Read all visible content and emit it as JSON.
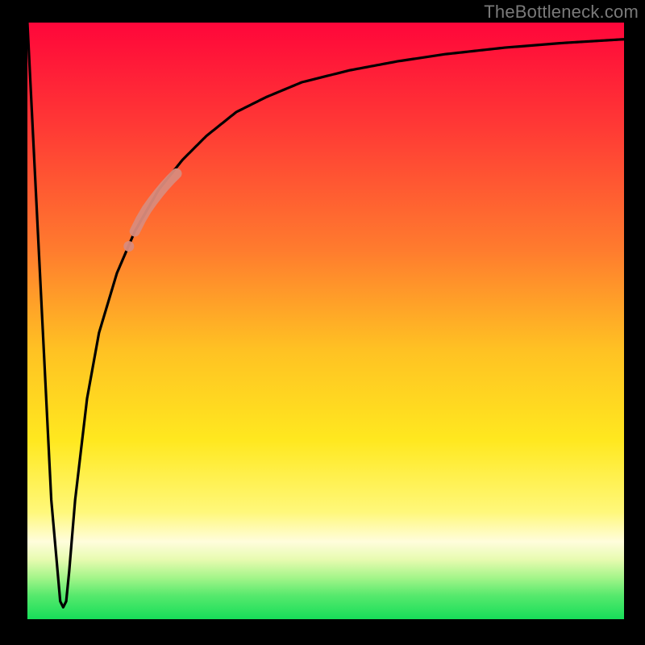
{
  "watermark": "TheBottleneck.com",
  "chart_data": {
    "type": "line",
    "title": "",
    "xlabel": "",
    "ylabel": "",
    "xlim": [
      0,
      100
    ],
    "ylim": [
      0,
      100
    ],
    "grid": false,
    "legend": false,
    "background_gradient": {
      "direction": "vertical",
      "stops": [
        {
          "pos": 0.0,
          "color": "#ff063a"
        },
        {
          "pos": 0.18,
          "color": "#ff3b35"
        },
        {
          "pos": 0.38,
          "color": "#ff7b2e"
        },
        {
          "pos": 0.55,
          "color": "#ffc223"
        },
        {
          "pos": 0.7,
          "color": "#ffe81f"
        },
        {
          "pos": 0.82,
          "color": "#fff87a"
        },
        {
          "pos": 0.87,
          "color": "#fffddc"
        },
        {
          "pos": 0.9,
          "color": "#e7fbb0"
        },
        {
          "pos": 0.93,
          "color": "#a5f58a"
        },
        {
          "pos": 0.96,
          "color": "#57e96d"
        },
        {
          "pos": 1.0,
          "color": "#17de59"
        }
      ]
    },
    "series": [
      {
        "name": "curve",
        "color": "#000000",
        "x": [
          0,
          2,
          4,
          5.5,
          6,
          6.5,
          7,
          8,
          10,
          12,
          15,
          18,
          22,
          26,
          30,
          35,
          40,
          46,
          54,
          62,
          70,
          80,
          90,
          100
        ],
        "y": [
          100,
          60,
          20,
          3,
          2,
          3,
          8,
          20,
          37,
          48,
          58,
          65,
          72,
          77,
          81,
          85,
          87.5,
          90,
          92,
          93.5,
          94.7,
          95.8,
          96.6,
          97.2
        ]
      },
      {
        "name": "highlight-segment",
        "color": "#d98b7c",
        "x": [
          18,
          19,
          20,
          21,
          22,
          23,
          24,
          25
        ],
        "y": [
          65,
          67,
          68.7,
          70.1,
          71.4,
          72.6,
          73.7,
          74.7
        ]
      },
      {
        "name": "highlight-dot",
        "color": "#d98b7c",
        "x": [
          17
        ],
        "y": [
          62.5
        ]
      }
    ]
  }
}
